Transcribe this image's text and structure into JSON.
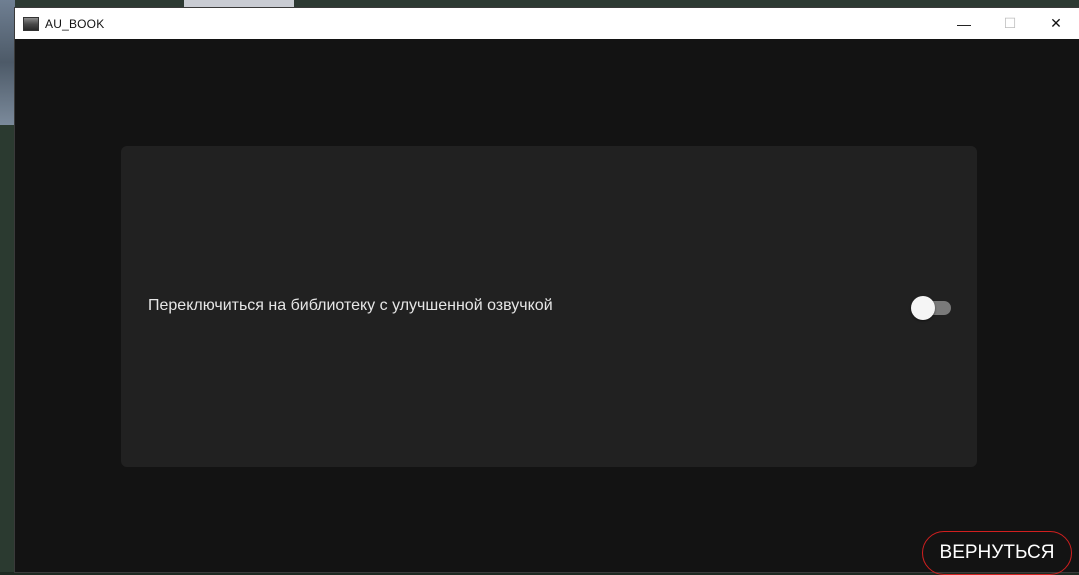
{
  "window": {
    "title": "AU_BOOK",
    "controls": {
      "minimize": "—",
      "maximize": "☐",
      "close": "✕"
    }
  },
  "settings": {
    "enhanced_voice_library": {
      "label": "Переключиться на библиотеку с улучшенной озвучкой",
      "enabled": false
    }
  },
  "footer": {
    "back_label": "ВЕРНУТЬСЯ"
  },
  "colors": {
    "window_bg": "#131313",
    "card_bg": "#212121",
    "back_button_border": "#d11f1f",
    "toggle_track": "#7a7a7a",
    "toggle_thumb": "#f5f5f5"
  }
}
